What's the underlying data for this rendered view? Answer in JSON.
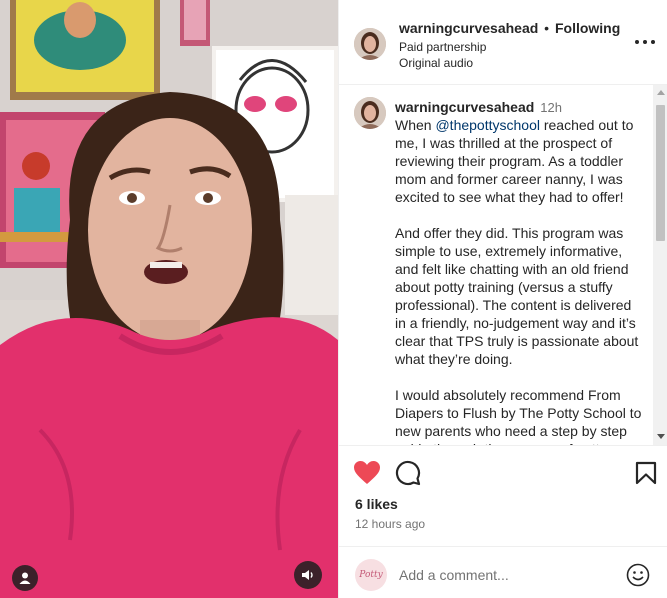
{
  "post": {
    "username": "warningcurvesahead",
    "separator": "•",
    "following_label": "Following",
    "paid_partnership": "Paid partnership",
    "audio": "Original audio"
  },
  "caption": {
    "username": "warningcurvesahead",
    "time": "12h",
    "p1_before": "When ",
    "p1_mention": "@thepottyschool",
    "p1_after": " reached out to me, I was thrilled at the prospect of reviewing their program. As a toddler mom and former career nanny, I was excited to see what they had to offer!",
    "p2": "And offer they did. This program was simple to use, extremely informative, and felt like chatting with an old friend about potty training (versus a stuffy professional). The content is delivered in a friendly, no-judgement way and it’s clear that TPS truly is passionate about what they’re doing.",
    "p3": "I would absolutely recommend From Diapers to Flush by The Potty School to new parents who need a step by step guide through the process of potty training."
  },
  "stats": {
    "likes": "6 likes",
    "time_ago": "12 hours ago",
    "liked": true
  },
  "comment": {
    "placeholder": "Add a comment...",
    "avatar_text": "Potty"
  },
  "icons": {
    "media": [
      "person-icon",
      "volume-icon"
    ],
    "actions": [
      "heart-icon",
      "comment-icon",
      "bookmark-icon",
      "more-icon",
      "emoji-icon"
    ]
  },
  "colors": {
    "like": "#ed4956",
    "mention": "#00376b",
    "muted": "#737373",
    "sweater": "#e2306c"
  }
}
